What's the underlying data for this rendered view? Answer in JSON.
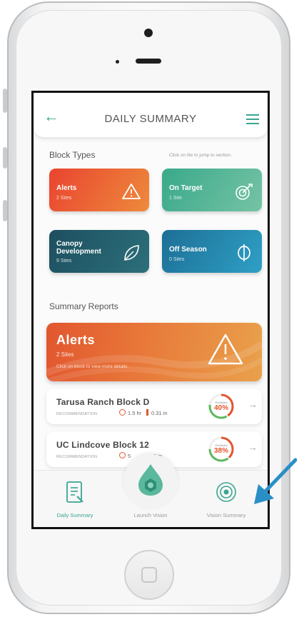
{
  "header": {
    "title": "DAILY SUMMARY"
  },
  "block_types": {
    "title": "Block Types",
    "hint": "Click on tile to jump to section.",
    "tiles": [
      {
        "name": "Alerts",
        "sub": "2 Sites",
        "icon": "warning-icon"
      },
      {
        "name": "On Target",
        "sub": "1 Site",
        "icon": "target-icon"
      },
      {
        "name": "Canopy",
        "name2": "Development",
        "sub": "9 Sites",
        "icon": "leaf-icon"
      },
      {
        "name": "Off Season",
        "sub": "0 Sites",
        "icon": "phi-icon"
      }
    ]
  },
  "summary_reports": {
    "title": "Summary Reports",
    "banner": {
      "title": "Alerts",
      "sub": "2 Sites",
      "hint": "Click on block to view more details."
    },
    "cards": [
      {
        "name": "Tarusa Ranch Block D",
        "recommendation": "RECOMMENDATION",
        "time": "1.5 hr",
        "rain": "0.31 in",
        "ring_caption": "Predicted",
        "ring_value": "40%",
        "ring_fraction": 0.4
      },
      {
        "name": "UC Lindcove Block 12",
        "recommendation": "RECOMMENDATION",
        "time": "5",
        "rain": "5 in",
        "ring_caption": "Predicted",
        "ring_value": "38%",
        "ring_fraction": 0.38
      }
    ]
  },
  "tabs": [
    {
      "label": "Daily Summary",
      "icon": "report-icon",
      "active": true
    },
    {
      "label": "Launch Vision",
      "icon": "drop-icon",
      "active": false
    },
    {
      "label": "Vision Summary",
      "icon": "vision-icon",
      "active": false
    }
  ],
  "colors": {
    "accent": "#3aa58f",
    "alert": "#e2562e",
    "on_target": "#3fa98b",
    "canopy": "#225a66",
    "off_season": "#1f7fa6"
  }
}
